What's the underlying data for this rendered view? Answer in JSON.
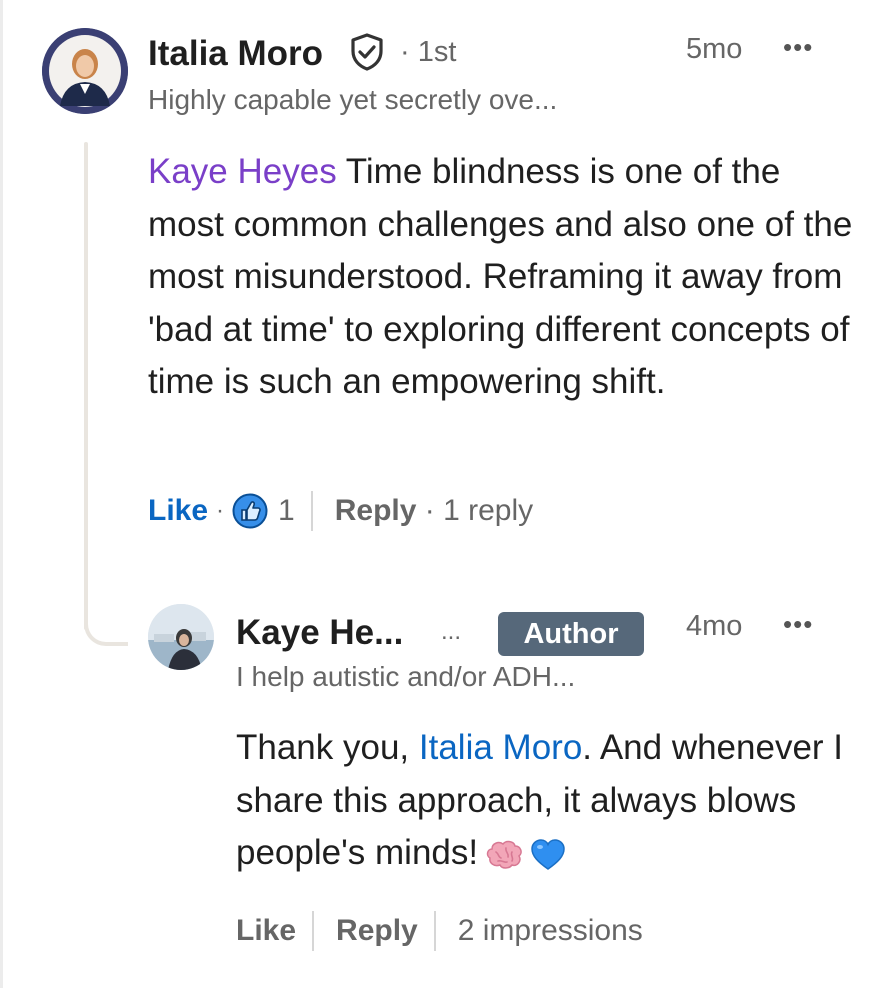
{
  "comment": {
    "author_name": "Italia Moro",
    "connection_degree": "· 1st",
    "headline": "Highly capable yet secretly ove...",
    "time": "5mo",
    "more_icon": "more-horizontal-icon",
    "verified_icon": "verified-shield-icon",
    "mention": "Kaye Heyes",
    "text": " Time blindness is one of the most common challenges and also one of the most misunderstood. Reframing it away from 'bad at time' to exploring different concepts of time is such an empowering shift.",
    "actions": {
      "like_label": "Like",
      "separator": "·",
      "reaction_icon": "thumbs-up-reaction-icon",
      "reaction_count": "1",
      "reply_label": "Reply",
      "reply_count": "· 1 reply"
    }
  },
  "reply": {
    "author_name": "Kaye He...",
    "ellipsis": "...",
    "badge": "Author",
    "headline": "I help autistic and/or ADH...",
    "time": "4mo",
    "more_icon": "more-horizontal-icon",
    "text_before": "Thank you, ",
    "mention": "Italia Moro",
    "text_after": ". And whenever I share this approach, it always blows people's minds!",
    "emojis": [
      "brain-emoji",
      "blue-heart-emoji"
    ],
    "actions": {
      "like_label": "Like",
      "reply_label": "Reply",
      "impressions": "2 impressions"
    }
  },
  "colors": {
    "like_blue": "#0a66c2",
    "mention_purple": "#7a3fc8",
    "badge_bg": "#56687a",
    "secondary_text": "#666666"
  }
}
